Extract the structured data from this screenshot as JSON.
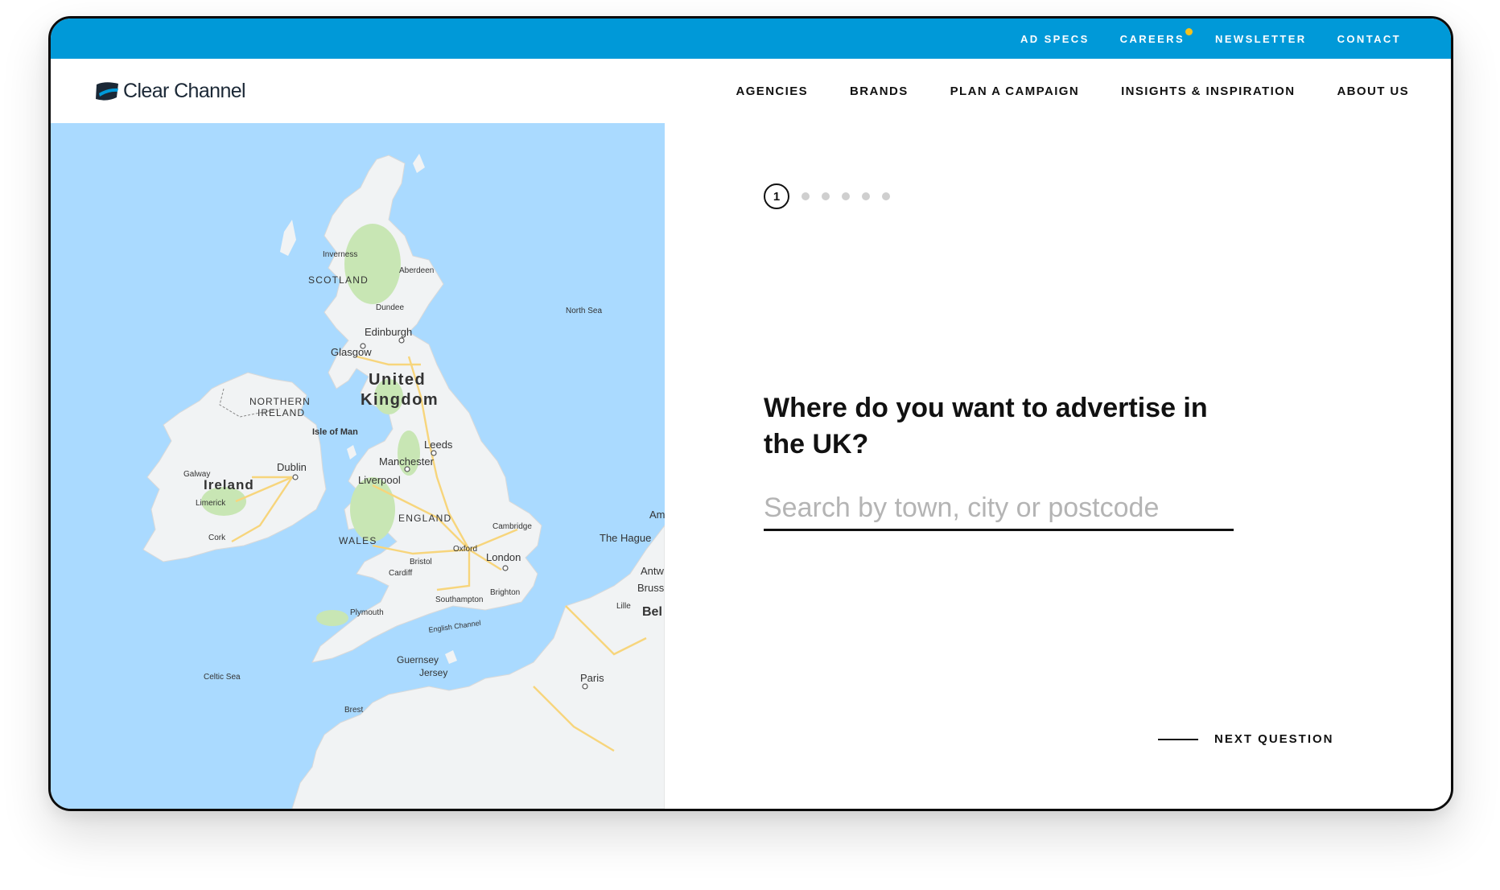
{
  "colors": {
    "topbar": "#0099d8",
    "badge": "#f4c21d",
    "sea": "#aadaff",
    "land": "#f1f3f4",
    "road": "#f7d57c",
    "green": "#c8e6b4"
  },
  "topbar": {
    "links": [
      {
        "label": "AD SPECS"
      },
      {
        "label": "CAREERS",
        "badge": true
      },
      {
        "label": "NEWSLETTER"
      },
      {
        "label": "CONTACT"
      }
    ]
  },
  "header": {
    "logo_text": "Clear Channel",
    "logo_icon": "clear-channel-swoosh-icon",
    "nav": [
      {
        "label": "AGENCIES"
      },
      {
        "label": "BRANDS"
      },
      {
        "label": "PLAN A CAMPAIGN"
      },
      {
        "label": "INSIGHTS & INSPIRATION"
      },
      {
        "label": "ABOUT US"
      }
    ]
  },
  "map": {
    "labels": {
      "inverness": "Inverness",
      "aberdeen": "Aberdeen",
      "scotland": "SCOTLAND",
      "dundee": "Dundee",
      "north_sea": "North Sea",
      "edinburgh": "Edinburgh",
      "glasgow": "Glasgow",
      "united": "United",
      "kingdom": "Kingdom",
      "northern": "NORTHERN",
      "ireland_ni": "IRELAND",
      "isle_of_man": "Isle of Man",
      "leeds": "Leeds",
      "manchester": "Manchester",
      "galway": "Galway",
      "dublin": "Dublin",
      "ireland": "Ireland",
      "liverpool": "Liverpool",
      "limerick": "Limerick",
      "england": "ENGLAND",
      "am": "Am",
      "cambridge": "Cambridge",
      "the_hague": "The Hague",
      "cork": "Cork",
      "wales": "WALES",
      "oxford": "Oxford",
      "london": "London",
      "antw": "Antw",
      "bristol": "Bristol",
      "cardiff": "Cardiff",
      "bruss": "Bruss",
      "brighton": "Brighton",
      "southampton": "Southampton",
      "lille": "Lille",
      "bel": "Bel",
      "plymouth": "Plymouth",
      "english_channel": "English Channel",
      "guernsey": "Guernsey",
      "jersey": "Jersey",
      "paris": "Paris",
      "celtic_sea": "Celtic Sea",
      "brest": "Brest"
    }
  },
  "wizard": {
    "current_step": "1",
    "total_steps": 6,
    "question": "Where do you want to advertise in the UK?",
    "search_placeholder": "Search by town, city or postcode",
    "search_value": "",
    "next_label": "NEXT QUESTION"
  }
}
